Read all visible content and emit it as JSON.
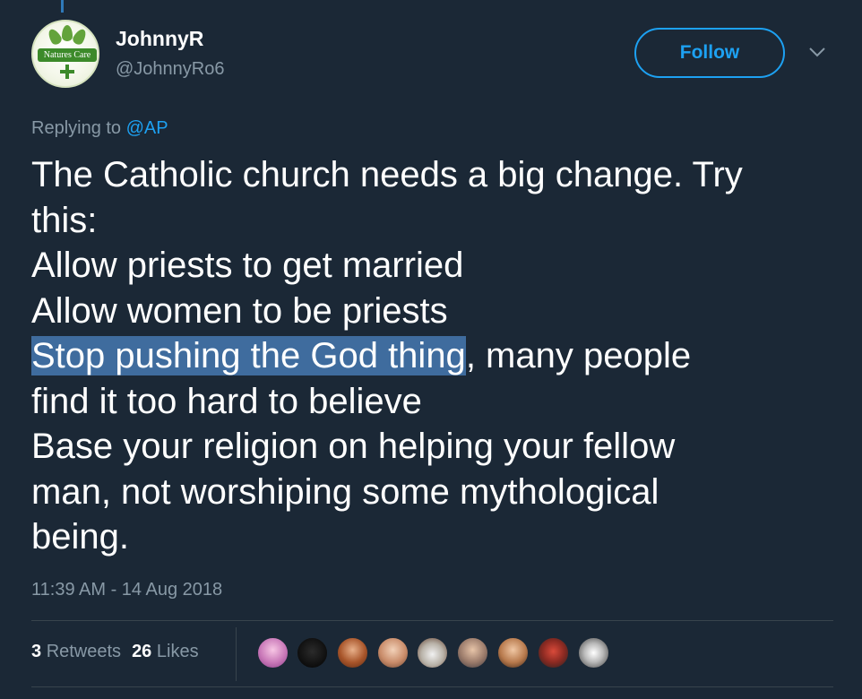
{
  "tweet": {
    "author": {
      "display_name": "JohnnyR",
      "handle": "@JohnnyRo6",
      "avatar_text": "Natures Care"
    },
    "follow_label": "Follow",
    "replying": {
      "prefix": "Replying to ",
      "mention": "@AP"
    },
    "text_lines": {
      "l1": "The Catholic church needs a big change. Try",
      "l2": "this:",
      "l3": "Allow priests to get married",
      "l4": "Allow women to be priests",
      "l5_highlighted": "Stop pushing the God thing",
      "l5_rest": ", many people",
      "l6": "find it too hard to believe",
      "l7": "Base your religion on helping your fellow",
      "l8": "man, not worshiping some mythological",
      "l9": "being."
    },
    "timestamp": "11:39 AM - 14 Aug 2018",
    "stats": {
      "retweets_count": "3",
      "retweets_label": "Retweets",
      "likes_count": "26",
      "likes_label": "Likes"
    },
    "likers_count": 9
  },
  "colors": {
    "background": "#1b2836",
    "accent": "#1da1f2",
    "muted_text": "#8899a6",
    "divider": "#38444d",
    "selection_highlight": "#3f6c9e"
  }
}
